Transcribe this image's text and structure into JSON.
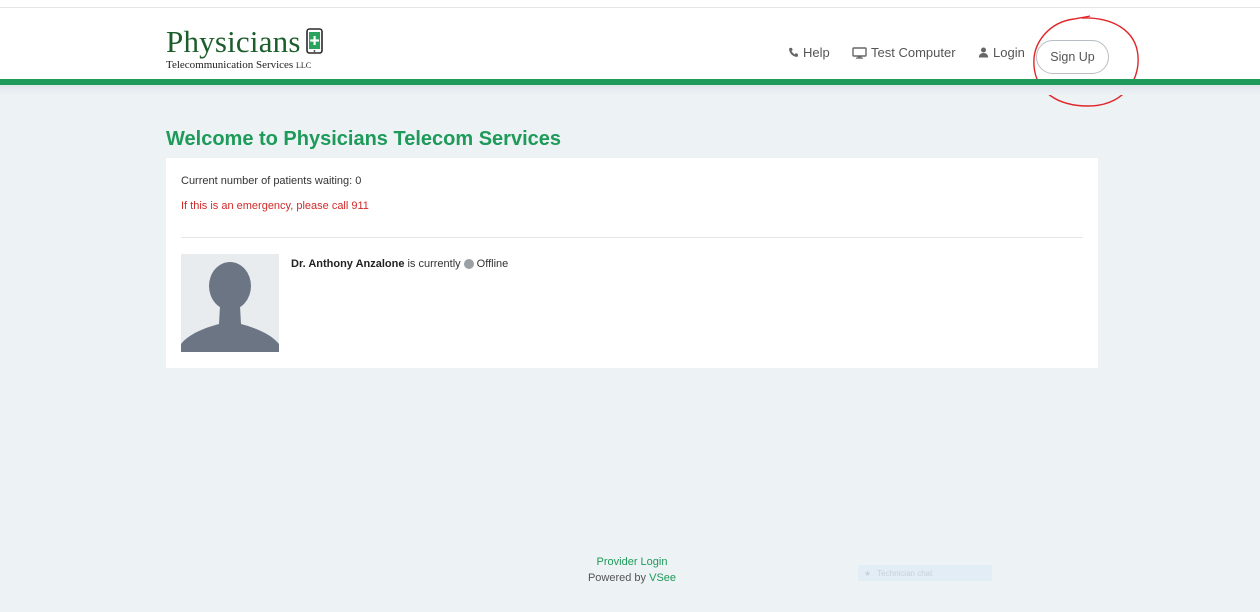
{
  "header": {
    "logo_title": "Physicians",
    "logo_subtitle": "Telecommunication Services",
    "logo_llc": "LLC",
    "nav": {
      "help": "Help",
      "test_computer": "Test Computer",
      "login": "Login",
      "sign_up": "Sign Up"
    }
  },
  "main": {
    "title": "Welcome to Physicians Telecom Services",
    "waiting_text": "Current number of patients waiting: 0",
    "emergency_text": "If this is an emergency, please call 911",
    "provider": {
      "name": "Dr. Anthony Anzalone",
      "status_prefix": "is currently",
      "status": "Offline"
    }
  },
  "footer": {
    "provider_login": "Provider Login",
    "powered_by": "Powered by",
    "brand": "VSee",
    "widget_text": "Technician chat"
  },
  "colors": {
    "brand_green": "#1e9a5a",
    "logo_green": "#1d5c2b",
    "emergency_red": "#d22a2a",
    "annotation_red": "#e0262b",
    "offline_gray": "#9aa0a4"
  },
  "icons": [
    "phone-icon",
    "monitor-icon",
    "user-icon",
    "phone-plus-icon",
    "status-dot-icon"
  ]
}
